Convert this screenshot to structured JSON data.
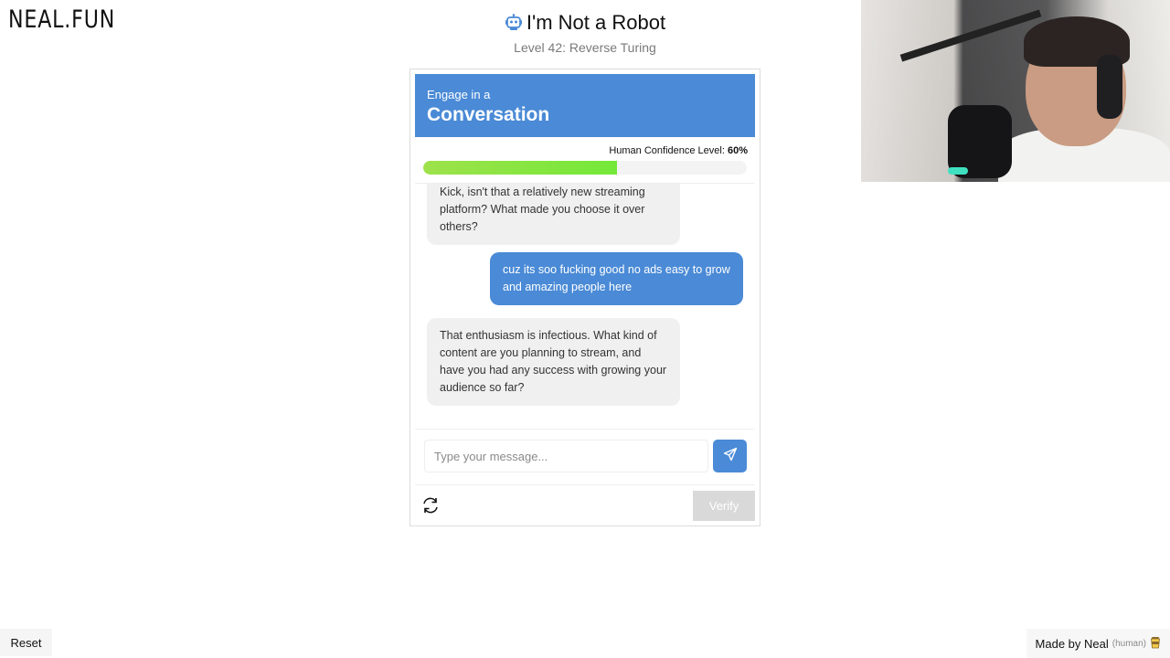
{
  "site": {
    "logo": "NEAL.FUN"
  },
  "header": {
    "title": "I'm Not a Robot",
    "subtitle": "Level 42: Reverse Turing",
    "icon": "robot-icon"
  },
  "banner": {
    "line1": "Engage in a",
    "line2": "Conversation",
    "color": "#4a8ad6"
  },
  "confidence": {
    "label": "Human Confidence Level:",
    "value_text": "60%",
    "fraction": 0.6
  },
  "chat": {
    "messages": [
      {
        "role": "bot",
        "text": "Kick, isn't that a relatively new streaming platform? What made you choose it over others?"
      },
      {
        "role": "user",
        "text": "cuz its soo fucking good no ads easy to grow and amazing people here"
      },
      {
        "role": "bot",
        "text": "That enthusiasm is infectious. What kind of content are you planning to stream, and have you had any success with growing your audience so far?"
      }
    ]
  },
  "input": {
    "placeholder": "Type your message...",
    "value": ""
  },
  "actions": {
    "send_icon": "send-icon",
    "refresh_icon": "refresh-icon",
    "verify_label": "Verify"
  },
  "footer": {
    "reset_label": "Reset",
    "made_by": "Made by Neal",
    "human_tag": "(human)",
    "cup_icon": "coffee-cup-icon"
  }
}
